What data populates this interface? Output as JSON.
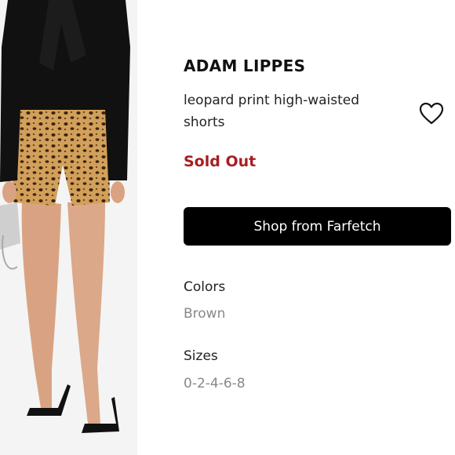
{
  "product": {
    "brand": "ADAM LIPPES",
    "name": "leopard print high-waisted shorts",
    "status": "Sold Out",
    "cta_label": "Shop from Farfetch",
    "colors_label": "Colors",
    "colors_value": "Brown",
    "sizes_label": "Sizes",
    "sizes_value": "0-2-4-6-8"
  },
  "icons": {
    "like": "heart-outline-icon"
  },
  "colors": {
    "status_red": "#a61e22",
    "button_bg": "#000000",
    "muted_text": "#888888"
  }
}
